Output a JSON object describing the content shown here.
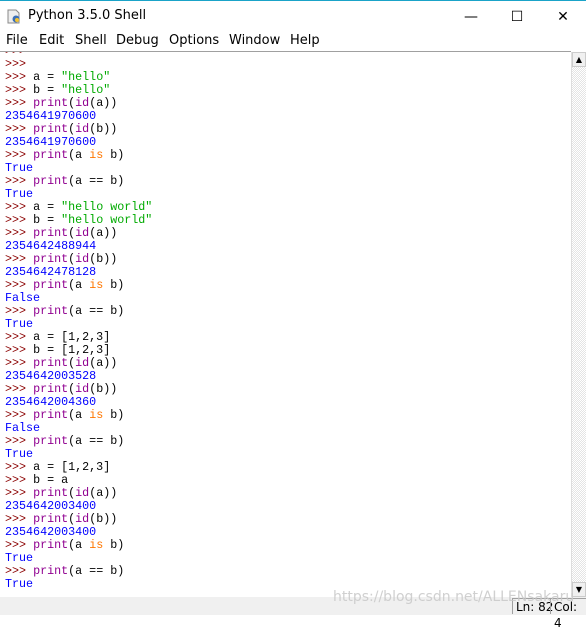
{
  "window": {
    "title": "Python 3.5.0 Shell",
    "minimize": "—",
    "maximize": "☐",
    "close": "✕"
  },
  "menu": [
    "File",
    "Edit",
    "Shell",
    "Debug",
    "Options",
    "Window",
    "Help"
  ],
  "colors": {
    "prompt": "#8b0000",
    "string": "#00aa00",
    "builtin": "#900090",
    "output": "#0000ff",
    "keyword": "#ff7700"
  },
  "shell_lines": [
    [
      [
        "prompt",
        ">>>"
      ]
    ],
    [
      [
        "prompt",
        ">>>"
      ]
    ],
    [
      [
        "prompt",
        ">>> "
      ],
      [
        "plain",
        "a = "
      ],
      [
        "str",
        "\"hello\""
      ]
    ],
    [
      [
        "prompt",
        ">>> "
      ],
      [
        "plain",
        "b = "
      ],
      [
        "str",
        "\"hello\""
      ]
    ],
    [
      [
        "prompt",
        ">>> "
      ],
      [
        "builtin",
        "print"
      ],
      [
        "plain",
        "("
      ],
      [
        "builtin",
        "id"
      ],
      [
        "plain",
        "(a))"
      ]
    ],
    [
      [
        "out",
        "2354641970600"
      ]
    ],
    [
      [
        "prompt",
        ">>> "
      ],
      [
        "builtin",
        "print"
      ],
      [
        "plain",
        "("
      ],
      [
        "builtin",
        "id"
      ],
      [
        "plain",
        "(b))"
      ]
    ],
    [
      [
        "out",
        "2354641970600"
      ]
    ],
    [
      [
        "prompt",
        ">>> "
      ],
      [
        "builtin",
        "print"
      ],
      [
        "plain",
        "(a "
      ],
      [
        "kw",
        "is"
      ],
      [
        "plain",
        " b)"
      ]
    ],
    [
      [
        "out",
        "True"
      ]
    ],
    [
      [
        "prompt",
        ">>> "
      ],
      [
        "builtin",
        "print"
      ],
      [
        "plain",
        "(a == b)"
      ]
    ],
    [
      [
        "out",
        "True"
      ]
    ],
    [
      [
        "prompt",
        ">>> "
      ],
      [
        "plain",
        "a = "
      ],
      [
        "str",
        "\"hello world\""
      ]
    ],
    [
      [
        "prompt",
        ">>> "
      ],
      [
        "plain",
        "b = "
      ],
      [
        "str",
        "\"hello world\""
      ]
    ],
    [
      [
        "prompt",
        ">>> "
      ],
      [
        "builtin",
        "print"
      ],
      [
        "plain",
        "("
      ],
      [
        "builtin",
        "id"
      ],
      [
        "plain",
        "(a))"
      ]
    ],
    [
      [
        "out",
        "2354642488944"
      ]
    ],
    [
      [
        "prompt",
        ">>> "
      ],
      [
        "builtin",
        "print"
      ],
      [
        "plain",
        "("
      ],
      [
        "builtin",
        "id"
      ],
      [
        "plain",
        "(b))"
      ]
    ],
    [
      [
        "out",
        "2354642478128"
      ]
    ],
    [
      [
        "prompt",
        ">>> "
      ],
      [
        "builtin",
        "print"
      ],
      [
        "plain",
        "(a "
      ],
      [
        "kw",
        "is"
      ],
      [
        "plain",
        " b)"
      ]
    ],
    [
      [
        "out",
        "False"
      ]
    ],
    [
      [
        "prompt",
        ">>> "
      ],
      [
        "builtin",
        "print"
      ],
      [
        "plain",
        "(a == b)"
      ]
    ],
    [
      [
        "out",
        "True"
      ]
    ],
    [
      [
        "prompt",
        ">>> "
      ],
      [
        "plain",
        "a = [1,2,3]"
      ]
    ],
    [
      [
        "prompt",
        ">>> "
      ],
      [
        "plain",
        "b = [1,2,3]"
      ]
    ],
    [
      [
        "prompt",
        ">>> "
      ],
      [
        "builtin",
        "print"
      ],
      [
        "plain",
        "("
      ],
      [
        "builtin",
        "id"
      ],
      [
        "plain",
        "(a))"
      ]
    ],
    [
      [
        "out",
        "2354642003528"
      ]
    ],
    [
      [
        "prompt",
        ">>> "
      ],
      [
        "builtin",
        "print"
      ],
      [
        "plain",
        "("
      ],
      [
        "builtin",
        "id"
      ],
      [
        "plain",
        "(b))"
      ]
    ],
    [
      [
        "out",
        "2354642004360"
      ]
    ],
    [
      [
        "prompt",
        ">>> "
      ],
      [
        "builtin",
        "print"
      ],
      [
        "plain",
        "(a "
      ],
      [
        "kw",
        "is"
      ],
      [
        "plain",
        " b)"
      ]
    ],
    [
      [
        "out",
        "False"
      ]
    ],
    [
      [
        "prompt",
        ">>> "
      ],
      [
        "builtin",
        "print"
      ],
      [
        "plain",
        "(a == b)"
      ]
    ],
    [
      [
        "out",
        "True"
      ]
    ],
    [
      [
        "prompt",
        ">>> "
      ],
      [
        "plain",
        "a = [1,2,3]"
      ]
    ],
    [
      [
        "prompt",
        ">>> "
      ],
      [
        "plain",
        "b = a"
      ]
    ],
    [
      [
        "prompt",
        ">>> "
      ],
      [
        "builtin",
        "print"
      ],
      [
        "plain",
        "("
      ],
      [
        "builtin",
        "id"
      ],
      [
        "plain",
        "(a))"
      ]
    ],
    [
      [
        "out",
        "2354642003400"
      ]
    ],
    [
      [
        "prompt",
        ">>> "
      ],
      [
        "builtin",
        "print"
      ],
      [
        "plain",
        "("
      ],
      [
        "builtin",
        "id"
      ],
      [
        "plain",
        "(b))"
      ]
    ],
    [
      [
        "out",
        "2354642003400"
      ]
    ],
    [
      [
        "prompt",
        ">>> "
      ],
      [
        "builtin",
        "print"
      ],
      [
        "plain",
        "(a "
      ],
      [
        "kw",
        "is"
      ],
      [
        "plain",
        " b)"
      ]
    ],
    [
      [
        "out",
        "True"
      ]
    ],
    [
      [
        "prompt",
        ">>> "
      ],
      [
        "builtin",
        "print"
      ],
      [
        "plain",
        "(a == b)"
      ]
    ],
    [
      [
        "out",
        "True"
      ]
    ]
  ],
  "status": {
    "line": "Ln: 82",
    "col": "Col: 4"
  },
  "watermark": "https://blog.csdn.net/ALLENsakaru"
}
